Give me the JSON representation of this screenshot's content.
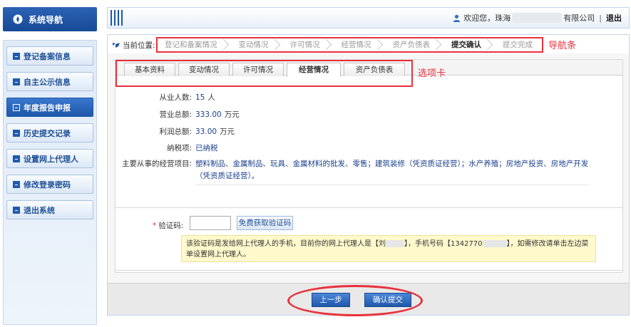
{
  "sidebar": {
    "title": "系统导航",
    "items": [
      {
        "label": "登记备案信息",
        "active": false
      },
      {
        "label": "自主公示信息",
        "active": false
      },
      {
        "label": "年度报告申报",
        "active": true
      },
      {
        "label": "历史提交记录",
        "active": false
      },
      {
        "label": "设置网上代理人",
        "active": false
      },
      {
        "label": "修改登录密码",
        "active": false
      },
      {
        "label": "退出系统",
        "active": false
      }
    ]
  },
  "header": {
    "welcome_prefix": "欢迎您，珠海",
    "company_suffix": "有限公司",
    "separator": "|",
    "logout": "退出"
  },
  "breadcrumb": {
    "label": "当前位置:",
    "steps": [
      {
        "label": "登记和备案情况",
        "current": false
      },
      {
        "label": "变动情况",
        "current": false
      },
      {
        "label": "许可情况",
        "current": false
      },
      {
        "label": "经营情况",
        "current": false
      },
      {
        "label": "资产负债表",
        "current": false
      },
      {
        "label": "提交确认",
        "current": true
      },
      {
        "label": "提交完成",
        "current": false
      }
    ],
    "annotation": "导航条"
  },
  "tabs": {
    "items": [
      {
        "label": "基本资料",
        "active": false
      },
      {
        "label": "变动情况",
        "active": false
      },
      {
        "label": "许可情况",
        "active": false
      },
      {
        "label": "经营情况",
        "active": true
      },
      {
        "label": "资产负债表",
        "active": false
      }
    ],
    "annotation": "选项卡"
  },
  "business": {
    "employees_label": "从业人数:",
    "employees_value": "15",
    "employees_unit": "人",
    "revenue_label": "营业总额:",
    "revenue_value": "333.00",
    "revenue_unit": "万元",
    "profit_label": "利润总额:",
    "profit_value": "33.00",
    "profit_unit": "万元",
    "tax_label": "纳税项:",
    "tax_value": "已纳税",
    "scope_label": "主要从事的经营项目:",
    "scope_value": "塑料制品、金属制品、玩具、金属材料的批发、零售；建筑装修（凭资质证经营）；水产养殖；房地产投资、房地产开发（凭资质证经营）。"
  },
  "verify": {
    "star": "*",
    "label": "验证码:",
    "input_value": "",
    "get_code_button": "免费获取验证码",
    "notice_part1": "该验证码是发给网上代理人的手机，目前你的网上代理人是【刘",
    "notice_part2": "】，手机号码【1342770",
    "notice_part3": "】，如需修改请单击左边菜单设置网上代理人。"
  },
  "actions": {
    "prev_button": "上一步",
    "submit_button": "确认提交"
  },
  "colors": {
    "primary_blue": "#1d57a8",
    "annotation_red": "#e8323c",
    "notice_bg": "#fff9cc"
  }
}
